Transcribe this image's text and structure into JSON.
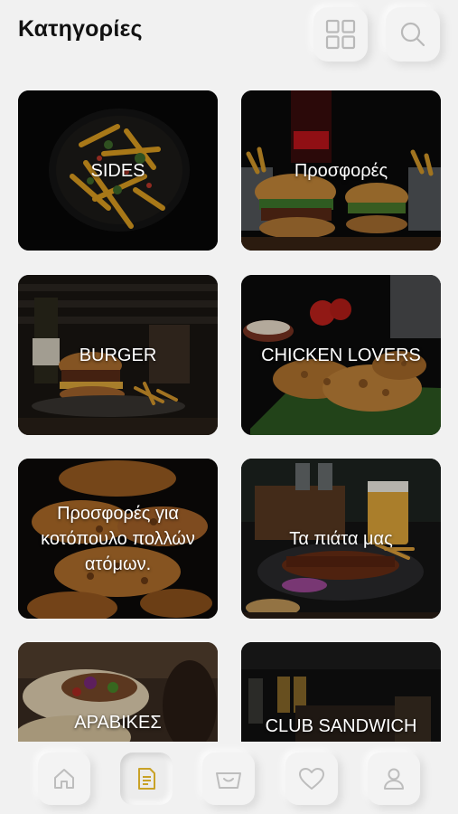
{
  "header": {
    "title": "Κατηγορίες",
    "grid_icon": "grid-icon",
    "search_icon": "search-icon"
  },
  "categories": [
    {
      "label": "SIDES"
    },
    {
      "label": "Προσφορές"
    },
    {
      "label": "BURGER"
    },
    {
      "label": "CHICKEN LOVERS"
    },
    {
      "label": "Προσφορές για κοτόπουλο πολλών ατόμων."
    },
    {
      "label": "Τα πιάτα μας"
    },
    {
      "label": "ΑΡΑΒΙΚΕΣ"
    },
    {
      "label": "CLUB SANDWICH"
    }
  ],
  "bottom_nav": {
    "items": [
      {
        "icon": "home-icon",
        "active": false
      },
      {
        "icon": "menu-document-icon",
        "active": true
      },
      {
        "icon": "basket-icon",
        "active": false
      },
      {
        "icon": "heart-icon",
        "active": false
      },
      {
        "icon": "user-icon",
        "active": false
      }
    ]
  },
  "colors": {
    "background": "#f1f1f1",
    "accent": "#c9a227",
    "icon_gray": "#b8b8b8",
    "card_text": "#ffffff"
  }
}
